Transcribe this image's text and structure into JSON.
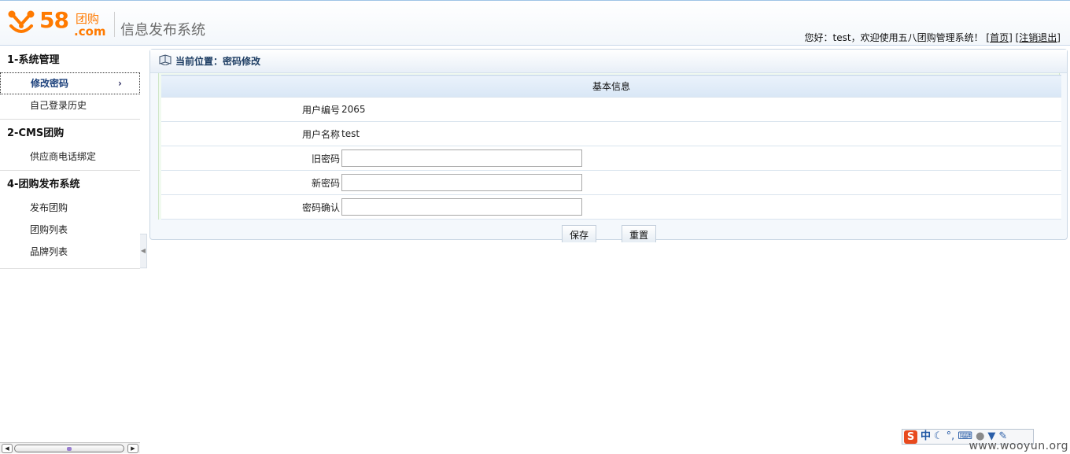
{
  "header": {
    "logo": {
      "number": "58",
      "tuangou": "团购",
      "com": ".com",
      "brand_color": "#ff7a00"
    },
    "system_title": "信息发布系统",
    "welcome_text": "您好：test，欢迎使用五八团购管理系统！",
    "home_link": "[首页]",
    "logout_link": "[注销退出]"
  },
  "sidebar": {
    "groups": [
      {
        "title": "1-系统管理",
        "items": [
          "修改密码",
          "自己登录历史"
        ]
      },
      {
        "title": "2-CMS团购",
        "items": [
          "供应商电话绑定"
        ]
      },
      {
        "title": "4-团购发布系统",
        "items": [
          "发布团购",
          "团购列表",
          "品牌列表"
        ]
      }
    ],
    "active_chevron": "›"
  },
  "main": {
    "location": "当前位置：密码修改",
    "section_title": "基本信息",
    "fields": {
      "user_id_label": "用户编号",
      "user_id_value": "2065",
      "username_label": "用户名称",
      "username_value": "test",
      "old_password_label": "旧密码",
      "new_password_label": "新密码",
      "confirm_password_label": "密码确认"
    },
    "buttons": {
      "save": "保存",
      "reset": "重置"
    }
  },
  "ime_toolbar": {
    "logo": "S",
    "mode": "中"
  },
  "watermark": "www.wooyun.org"
}
